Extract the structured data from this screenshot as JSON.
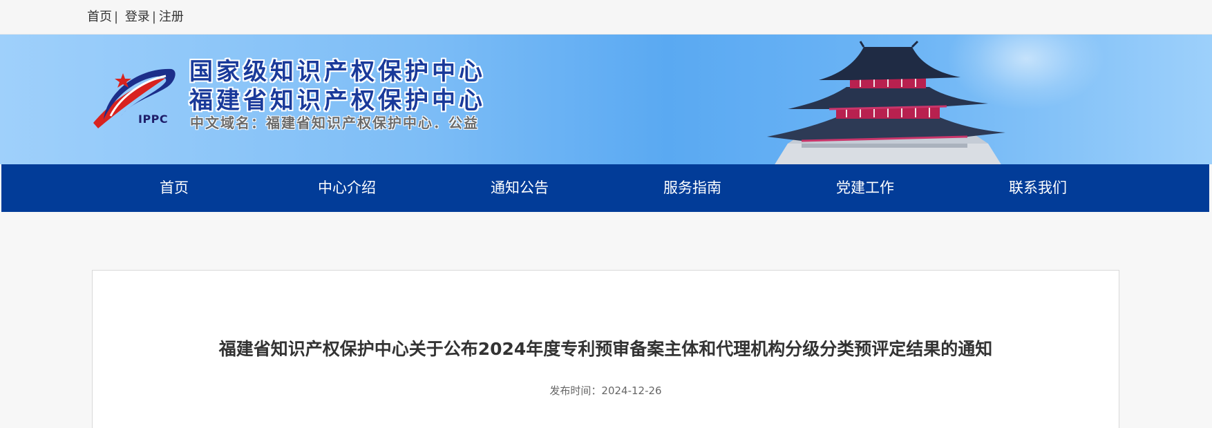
{
  "top_links": {
    "home": "首页",
    "login": "登录",
    "register": "注册",
    "separator": "|"
  },
  "banner": {
    "title_line_1": "国家级知识产权保护中心",
    "title_line_2": "福建省知识产权保护中心",
    "domain_text": "中文域名：福建省知识产权保护中心．公益",
    "logo_text": "IPPC",
    "colors": {
      "title": "#1a3a9a",
      "sky": "#5aa9f2"
    }
  },
  "nav": {
    "color": "#023c98",
    "items": [
      {
        "label": "首页"
      },
      {
        "label": "中心介绍"
      },
      {
        "label": "通知公告"
      },
      {
        "label": "服务指南"
      },
      {
        "label": "党建工作"
      },
      {
        "label": "联系我们"
      }
    ]
  },
  "article": {
    "title": "福建省知识产权保护中心关于公布2024年度专利预审备案主体和代理机构分级分类预评定结果的通知",
    "publish_label": "发布时间：",
    "publish_date": "2024-12-26"
  }
}
